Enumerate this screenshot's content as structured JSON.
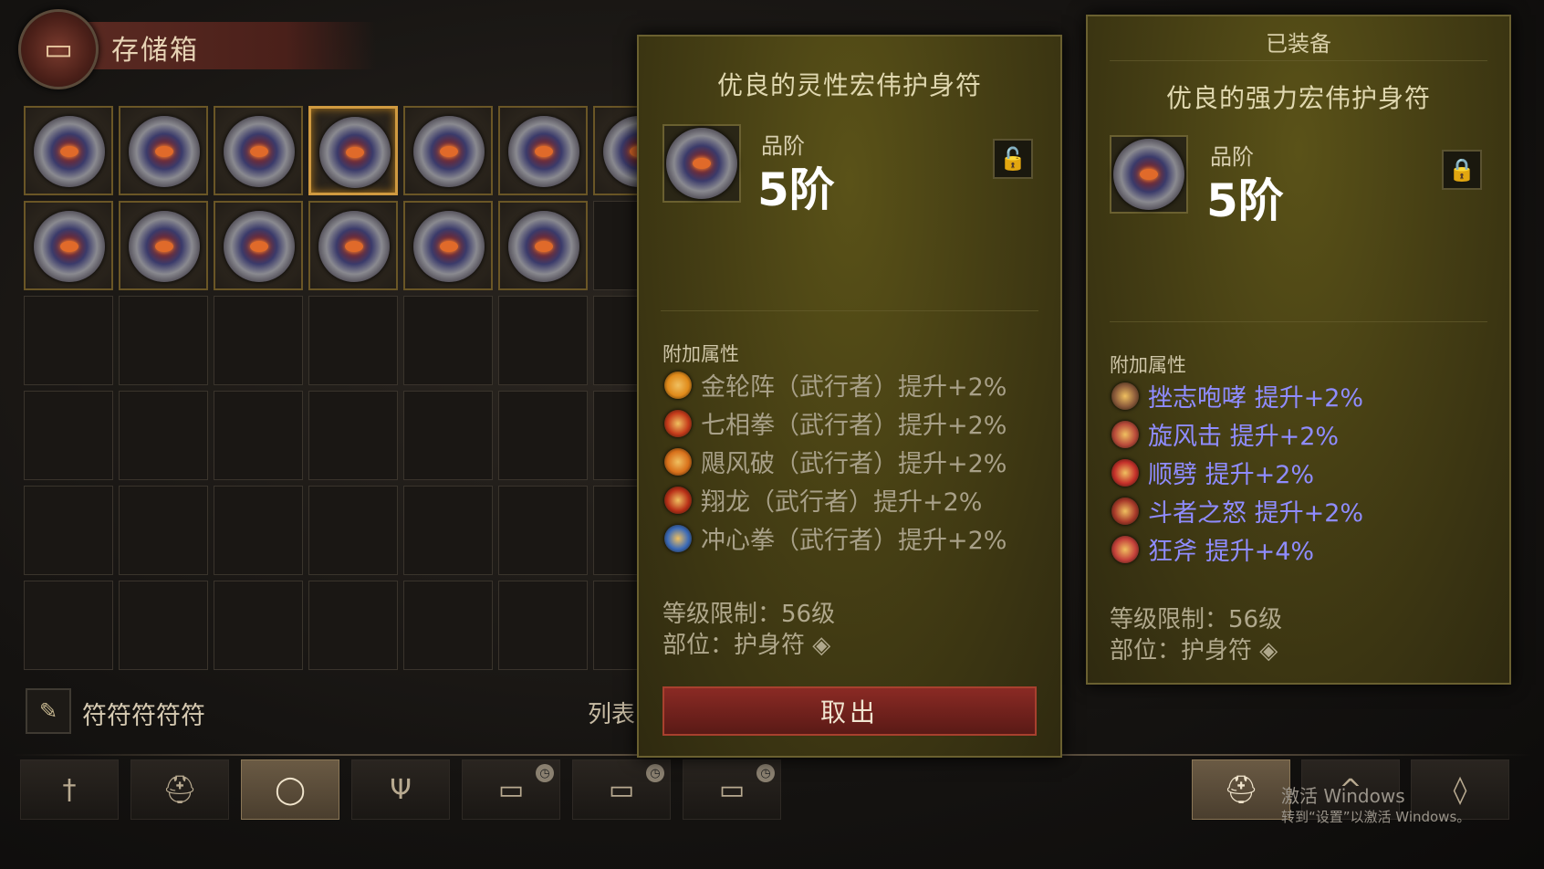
{
  "header": {
    "title": "存储箱",
    "icon": "chest-icon"
  },
  "grid": {
    "rows": [
      {
        "items": [
          "amulet",
          "amulet",
          "amulet",
          "amulet",
          "amulet",
          "amulet",
          "amulet"
        ]
      },
      {
        "items": [
          "amulet",
          "amulet",
          "amulet",
          "amulet",
          "amulet",
          "amulet"
        ]
      }
    ],
    "selected_index": 3
  },
  "filter": {
    "icon": "feather-icon",
    "text": "符符符符符"
  },
  "list_label": "列表",
  "tabs": [
    {
      "icon": "sword-icon",
      "glyph": "†"
    },
    {
      "icon": "helmet-icon",
      "glyph": "⛑"
    },
    {
      "icon": "ring-icon",
      "glyph": "◯",
      "active": true
    },
    {
      "icon": "trident-icon",
      "glyph": "Ψ"
    },
    {
      "icon": "chest-icon",
      "glyph": "▭",
      "clock": "clock-icon"
    },
    {
      "icon": "chest-icon",
      "glyph": "▭",
      "clock": "clock-icon"
    },
    {
      "icon": "chest-icon",
      "glyph": "▭",
      "clock": "clock-icon"
    }
  ],
  "right_tabs": [
    {
      "icon": "helmet-icon",
      "glyph": "⛑",
      "active": true
    },
    {
      "icon": "wing-icon",
      "glyph": "^"
    },
    {
      "icon": "bag-icon",
      "glyph": "◊"
    }
  ],
  "card_selected": {
    "title": "优良的灵性宏伟护身符",
    "grade_label": "品阶",
    "grade_value": "5阶",
    "lock_icon": "unlock-icon",
    "affix_label": "附加属性",
    "affixes": [
      {
        "text": "金轮阵（武行者）提升+2%",
        "icon": "golden-wheel-icon",
        "color": "#e08a1a"
      },
      {
        "text": "七相拳（武行者）提升+2%",
        "icon": "seven-fist-icon",
        "color": "#c43a1a"
      },
      {
        "text": "飓风破（武行者）提升+2%",
        "icon": "cyclone-icon",
        "color": "#d8701a"
      },
      {
        "text": "翔龙（武行者）提升+2%",
        "icon": "dragon-icon",
        "color": "#b83018"
      },
      {
        "text": "冲心拳（武行者）提升+2%",
        "icon": "dash-fist-icon",
        "color": "#3a6ab8"
      }
    ],
    "level_req": "等级限制：56级",
    "slot": "部位：护身符",
    "slot_icon": "amulet-slot-icon",
    "button": "取出"
  },
  "card_equipped": {
    "header": "已装备",
    "title": "优良的强力宏伟护身符",
    "grade_label": "品阶",
    "grade_value": "5阶",
    "lock_icon": "lock-icon",
    "affix_label": "附加属性",
    "affixes": [
      {
        "text": "挫志咆哮  提升+2%",
        "icon": "roar-icon",
        "color": "#8a5a3a"
      },
      {
        "text": "旋风击  提升+2%",
        "icon": "whirlwind-icon",
        "color": "#b84a3a"
      },
      {
        "text": "顺劈  提升+2%",
        "icon": "cleave-icon",
        "color": "#c4302a"
      },
      {
        "text": "斗者之怒  提升+2%",
        "icon": "fighter-wrath-icon",
        "color": "#a83a2a"
      },
      {
        "text": "狂斧  提升+4%",
        "icon": "frenzy-axe-icon",
        "color": "#c4403a"
      }
    ],
    "level_req": "等级限制：56级",
    "slot": "部位：护身符",
    "slot_icon": "amulet-slot-icon"
  },
  "watermark": {
    "line1": "激活 Windows",
    "line2": "转到“设置”以激活 Windows。"
  }
}
